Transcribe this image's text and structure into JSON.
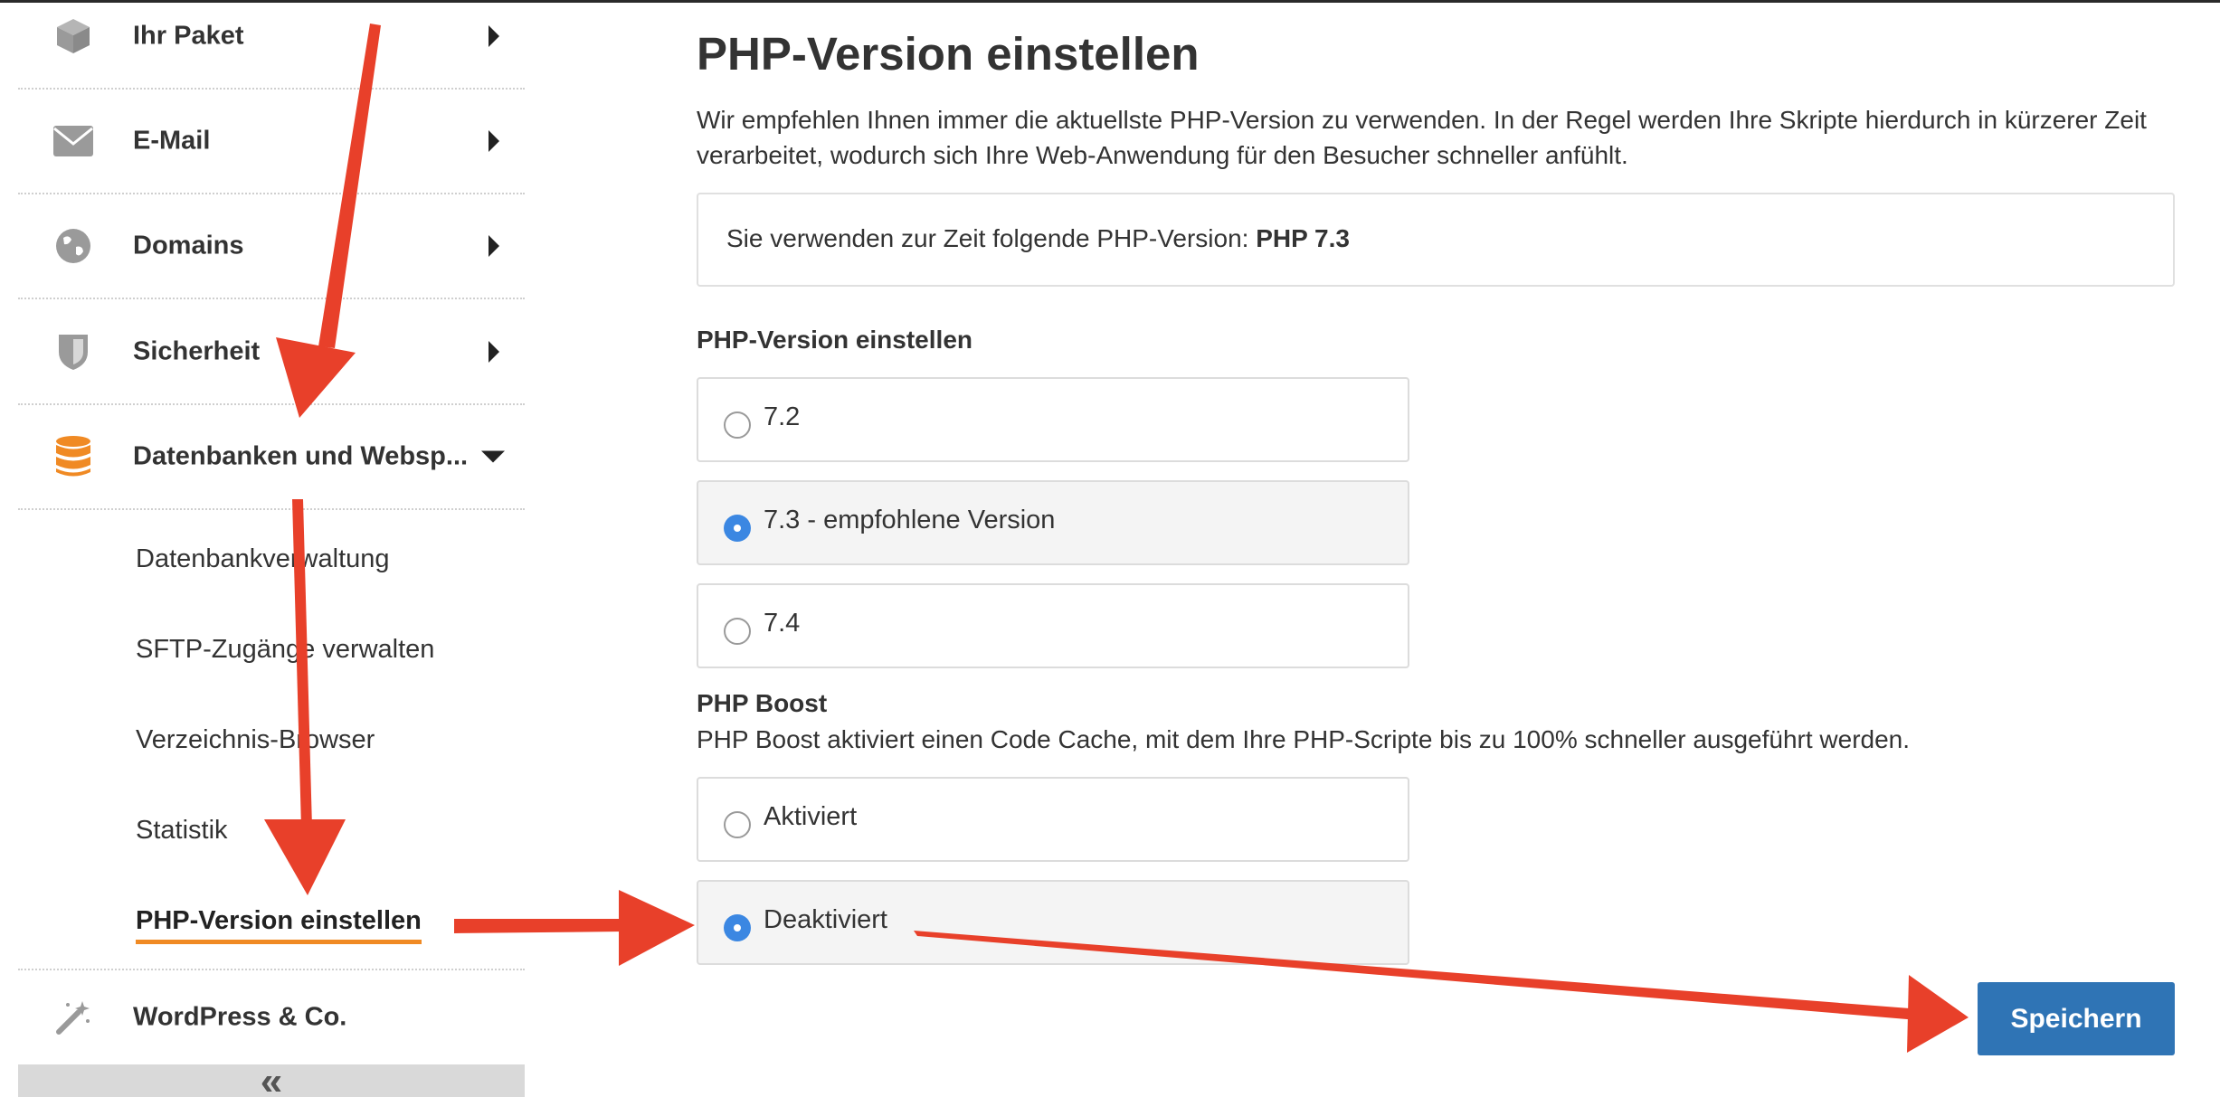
{
  "colors": {
    "accent_orange": "#f08a24",
    "radio_selected": "#3b87e2",
    "button_blue": "#2f74b5",
    "annotation_red": "#e8402a"
  },
  "sidebar": {
    "items": [
      {
        "label": "Ihr Paket",
        "icon": "package-icon"
      },
      {
        "label": "E-Mail",
        "icon": "envelope-icon"
      },
      {
        "label": "Domains",
        "icon": "globe-icon"
      },
      {
        "label": "Sicherheit",
        "icon": "shield-icon"
      },
      {
        "label": "Datenbanken und Websp...",
        "icon": "database-icon",
        "expanded": true
      },
      {
        "label": "WordPress & Co.",
        "icon": "magic-wand-icon"
      }
    ],
    "subitems": [
      {
        "label": "Datenbankverwaltung"
      },
      {
        "label": "SFTP-Zugänge verwalten"
      },
      {
        "label": "Verzeichnis-Browser"
      },
      {
        "label": "Statistik"
      },
      {
        "label": "PHP-Version einstellen",
        "active": true
      }
    ],
    "collapse_label": "«"
  },
  "main": {
    "title": "PHP-Version einstellen",
    "intro": "Wir empfehlen Ihnen immer die aktuellste PHP-Version zu verwenden. In der Regel werden Ihre Skripte hierdurch in kürzerer Zeit verarbeitet, wodurch sich Ihre Web-Anwendung für den Besucher schneller anfühlt.",
    "current_prefix": "Sie verwenden zur Zeit folgende PHP-Version: ",
    "current_version": "PHP 7.3",
    "version_section_label": "PHP-Version einstellen",
    "version_options": [
      {
        "label": "7.2",
        "selected": false
      },
      {
        "label": "7.3 - empfohlene Version",
        "selected": true
      },
      {
        "label": "7.4",
        "selected": false
      }
    ],
    "boost_label": "PHP Boost",
    "boost_desc": "PHP Boost aktiviert einen Code Cache, mit dem Ihre PHP-Scripte bis zu 100% schneller ausgeführt werden.",
    "boost_options": [
      {
        "label": "Aktiviert",
        "selected": false
      },
      {
        "label": "Deaktiviert",
        "selected": true
      }
    ],
    "save_label": "Speichern"
  }
}
